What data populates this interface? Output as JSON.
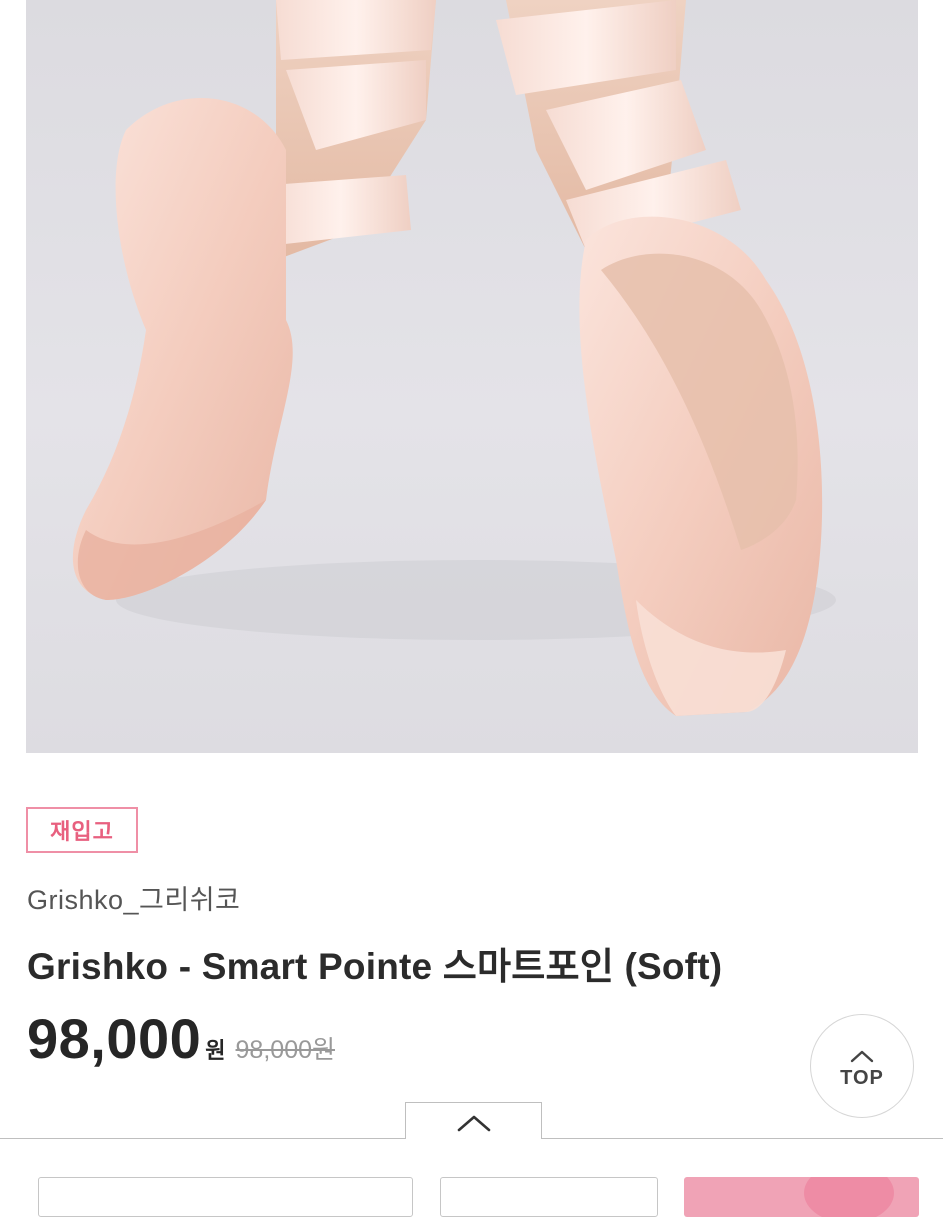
{
  "product": {
    "badge": "재입고",
    "brand": "Grishko_그리쉬코",
    "title": "Grishko - Smart Pointe 스마트포인 (Soft)",
    "price": "98,000",
    "price_unit": "원",
    "original_price": "98,000원"
  },
  "top_button": {
    "label": "TOP"
  },
  "colors": {
    "badge_border": "#ef8fa6",
    "badge_text": "#e8607f",
    "primary_button": "#f0a3b6",
    "photo_background": "#dcdbe0"
  },
  "icons": {
    "top_button": "chevron-up-icon",
    "sheet_toggle": "chevron-up-icon"
  }
}
